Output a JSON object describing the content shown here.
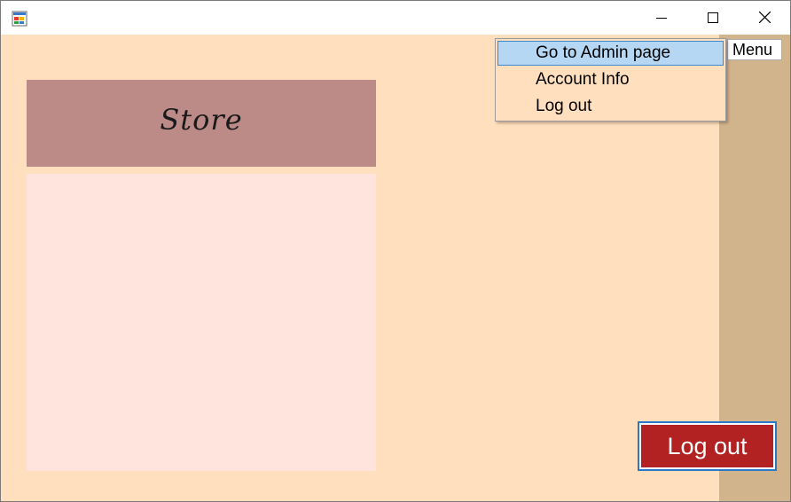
{
  "titlebar": {
    "icons": {
      "app": "windows-form-icon",
      "minimize": "minimize-icon",
      "maximize": "maximize-icon",
      "close": "close-icon"
    }
  },
  "store": {
    "title": "Store"
  },
  "menu": {
    "button_label": "Menu",
    "items": [
      {
        "label": "Go to Admin page",
        "highlighted": true
      },
      {
        "label": "Account Info",
        "highlighted": false
      },
      {
        "label": "Log out",
        "highlighted": false
      }
    ]
  },
  "logout_button": {
    "label": "Log out"
  },
  "colors": {
    "client_background": "#ffdfbd",
    "right_strip": "#d2b48c",
    "store_header": "#bc8b88",
    "store_body": "#ffe3dd",
    "logout_button": "#b22222",
    "menu_highlight": "#b5d7f3"
  }
}
